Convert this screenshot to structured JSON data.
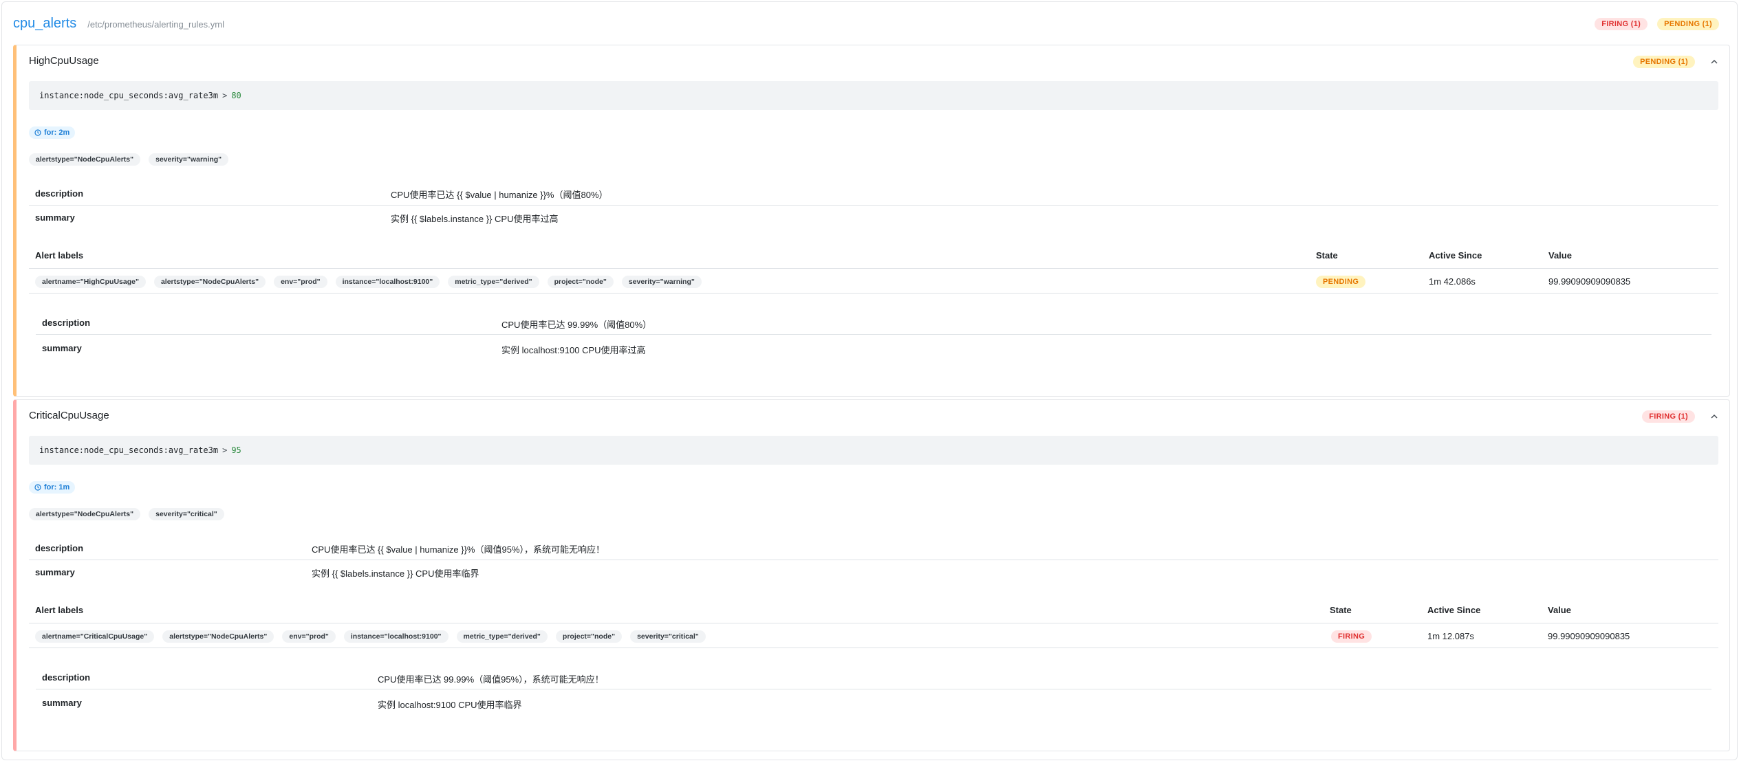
{
  "group": {
    "name": "cpu_alerts",
    "file": "/etc/prometheus/alerting_rules.yml",
    "badges": {
      "firing": "FIRING (1)",
      "pending": "PENDING (1)"
    }
  },
  "rules": [
    {
      "name": "HighCpuUsage",
      "badge": "PENDING (1)",
      "expr": {
        "metric": "instance:node_cpu_seconds:avg_rate3m",
        "op": ">",
        "threshold": "80"
      },
      "for": "for: 2m",
      "labels": [
        "alertstype=\"NodeCpuAlerts\"",
        "severity=\"warning\""
      ],
      "annotations": [
        {
          "key": "description",
          "value": "CPU使用率已达 {{ $value | humanize }}%（阈值80%）"
        },
        {
          "key": "summary",
          "value": "实例 {{ $labels.instance }} CPU使用率过高"
        }
      ],
      "alerts_table": {
        "headers": {
          "labels": "Alert labels",
          "state": "State",
          "active_since": "Active Since",
          "value": "Value"
        },
        "row": {
          "labels": [
            "alertname=\"HighCpuUsage\"",
            "alertstype=\"NodeCpuAlerts\"",
            "env=\"prod\"",
            "instance=\"localhost:9100\"",
            "metric_type=\"derived\"",
            "project=\"node\"",
            "severity=\"warning\""
          ],
          "state": "PENDING",
          "active_since": "1m 42.086s",
          "value": "99.99090909090835"
        },
        "annotations": [
          {
            "key": "description",
            "value": "CPU使用率已达 99.99%（阈值80%）"
          },
          {
            "key": "summary",
            "value": "实例 localhost:9100 CPU使用率过高"
          }
        ]
      }
    },
    {
      "name": "CriticalCpuUsage",
      "badge": "FIRING (1)",
      "expr": {
        "metric": "instance:node_cpu_seconds:avg_rate3m",
        "op": ">",
        "threshold": "95"
      },
      "for": "for: 1m",
      "labels": [
        "alertstype=\"NodeCpuAlerts\"",
        "severity=\"critical\""
      ],
      "annotations": [
        {
          "key": "description",
          "value": "CPU使用率已达 {{ $value | humanize }}%（阈值95%），系统可能无响应！"
        },
        {
          "key": "summary",
          "value": "实例 {{ $labels.instance }} CPU使用率临界"
        }
      ],
      "alerts_table": {
        "headers": {
          "labels": "Alert labels",
          "state": "State",
          "active_since": "Active Since",
          "value": "Value"
        },
        "row": {
          "labels": [
            "alertname=\"CriticalCpuUsage\"",
            "alertstype=\"NodeCpuAlerts\"",
            "env=\"prod\"",
            "instance=\"localhost:9100\"",
            "metric_type=\"derived\"",
            "project=\"node\"",
            "severity=\"critical\""
          ],
          "state": "FIRING",
          "active_since": "1m 12.087s",
          "value": "99.99090909090835"
        },
        "annotations": [
          {
            "key": "description",
            "value": "CPU使用率已达 99.99%（阈值95%），系统可能无响应！"
          },
          {
            "key": "summary",
            "value": "实例 localhost:9100 CPU使用率临界"
          }
        ]
      }
    }
  ],
  "colors": {
    "accent": "#228be6",
    "pending_border": "#ffc078",
    "firing_border": "#ffa8a8",
    "pending_badge_text": "#e67700",
    "firing_badge_text": "#e03131"
  },
  "icons": {
    "expand": "chevron-up-icon",
    "for_duration": "clock-icon"
  }
}
